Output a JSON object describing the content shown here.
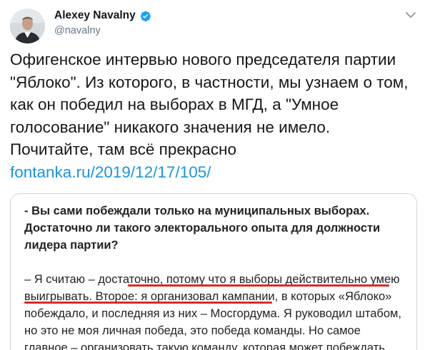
{
  "author": {
    "name": "Alexey Navalny",
    "handle": "@navalny",
    "verified": true,
    "verified_icon": "verified-badge-icon",
    "avatar_icon": "profile-photo"
  },
  "menu": {
    "icon": "chevron-down-icon"
  },
  "tweet": {
    "text": "Офигенское интервью нового председателя партии \"Яблоко\". Из которого, в частности, мы узнаем о том, как он победил на выборах в МГД, а \"Умное голосование\" никакого значения не имело. Почитайте, там всё прекрасно",
    "link": "fontanka.ru/2019/12/17/105/"
  },
  "card": {
    "question": "- Вы сами побеждали только на муниципальных выборах. Достаточно ли такого электорального опыта для должности лидера партии?",
    "answer": {
      "before": "– Я считаю – достаточно, потому что я выборы действительно умею выигрывать. Второе: ",
      "highlight": "я организовал кампании, в которых «Яблоко» побеждало, и последняя из них – Мосгордума",
      "after": ". Я руководил штабом, но это не моя личная победа, это победа команды. Но самое главное – организовать такую команду, которая может побеждать."
    }
  },
  "colors": {
    "link": "#1b95e0",
    "verified": "#1da1f2",
    "underline": "#d92b26",
    "handle": "#657786",
    "border": "#ccd6dd"
  }
}
